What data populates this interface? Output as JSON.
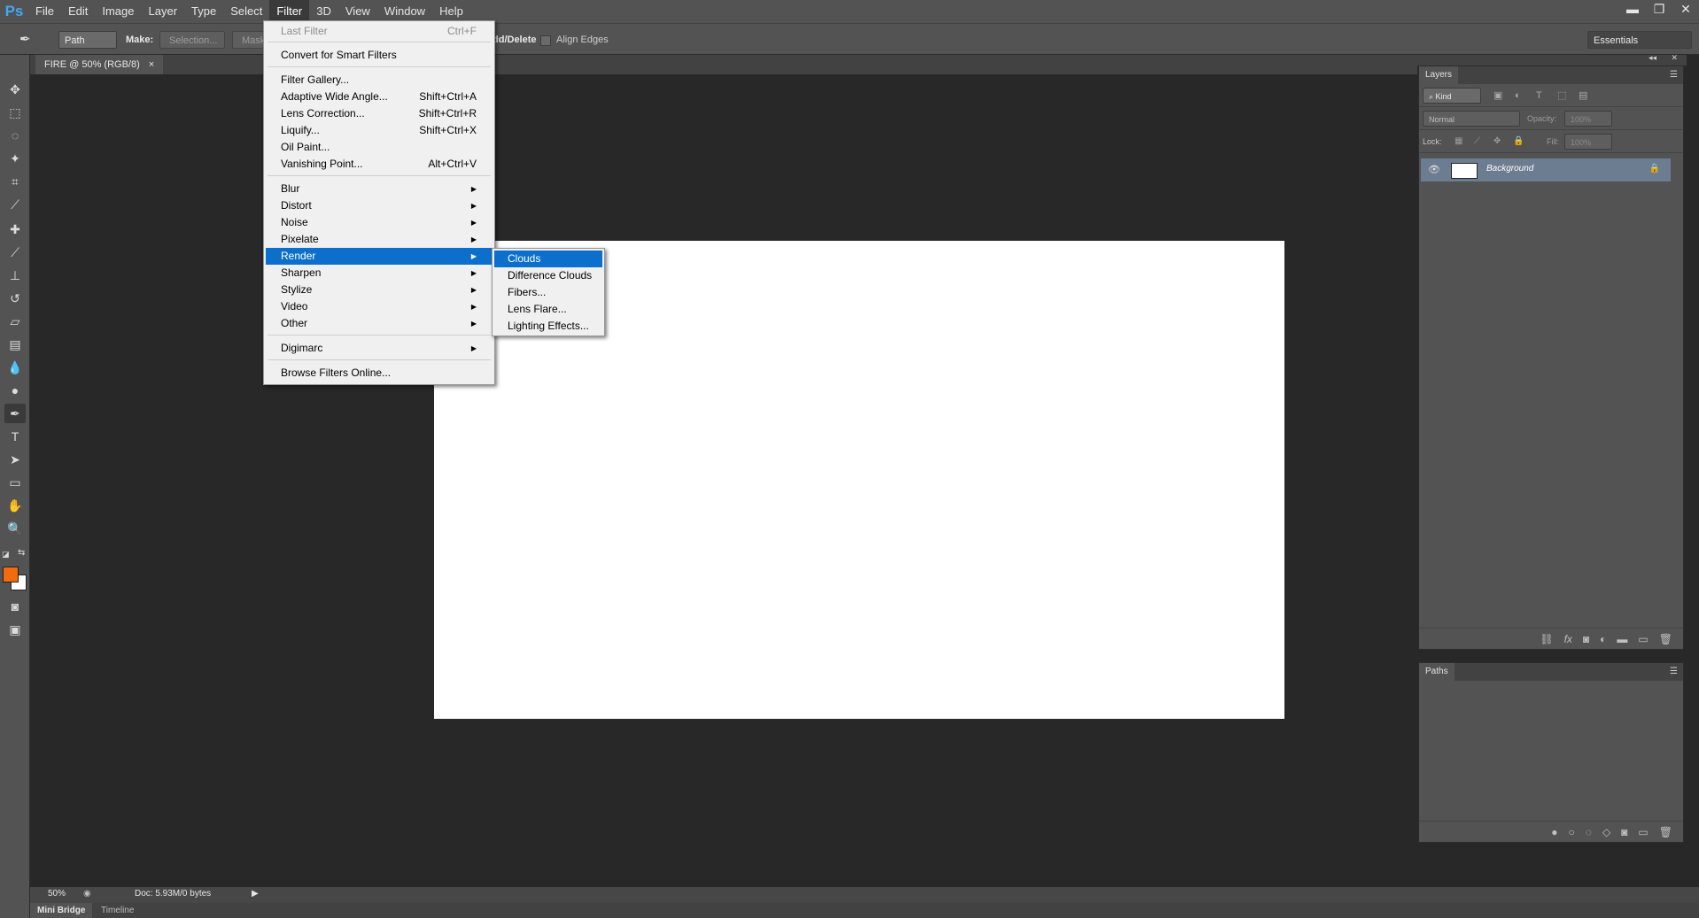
{
  "app": {
    "logo": "Ps",
    "menu": [
      "File",
      "Edit",
      "Image",
      "Layer",
      "Type",
      "Select",
      "Filter",
      "3D",
      "View",
      "Window",
      "Help"
    ],
    "active_menu": "Filter",
    "window_controls": {
      "minimize": "▬",
      "restore": "❐",
      "close": "✕"
    }
  },
  "options_bar": {
    "mode_select": "Path",
    "make_label": "Make:",
    "selection_button": "Selection...",
    "mask_button": "Mask",
    "auto_add_delete": "dd/Delete",
    "align_edges": "Align Edges",
    "workspace": "Essentials"
  },
  "document": {
    "tab_title": "FIRE @ 50% (RGB/8)",
    "tab_close": "×"
  },
  "filter_menu": {
    "items": [
      {
        "label": "Last Filter",
        "shortcut": "Ctrl+F",
        "disabled": true
      },
      {
        "label": "Convert for Smart Filters",
        "shortcut": ""
      },
      {
        "label": "Filter Gallery...",
        "shortcut": ""
      },
      {
        "label": "Adaptive Wide Angle...",
        "shortcut": "Shift+Ctrl+A"
      },
      {
        "label": "Lens Correction...",
        "shortcut": "Shift+Ctrl+R"
      },
      {
        "label": "Liquify...",
        "shortcut": "Shift+Ctrl+X"
      },
      {
        "label": "Oil Paint...",
        "shortcut": ""
      },
      {
        "label": "Vanishing Point...",
        "shortcut": "Alt+Ctrl+V"
      },
      {
        "label": "Blur",
        "submenu": true
      },
      {
        "label": "Distort",
        "submenu": true
      },
      {
        "label": "Noise",
        "submenu": true
      },
      {
        "label": "Pixelate",
        "submenu": true
      },
      {
        "label": "Render",
        "submenu": true,
        "highlight": true
      },
      {
        "label": "Sharpen",
        "submenu": true
      },
      {
        "label": "Stylize",
        "submenu": true
      },
      {
        "label": "Video",
        "submenu": true
      },
      {
        "label": "Other",
        "submenu": true
      },
      {
        "label": "Digimarc",
        "submenu": true
      },
      {
        "label": "Browse Filters Online...",
        "shortcut": ""
      }
    ]
  },
  "render_submenu": {
    "items": [
      "Clouds",
      "Difference Clouds",
      "Fibers...",
      "Lens Flare...",
      "Lighting Effects..."
    ],
    "highlighted": "Clouds"
  },
  "layers_panel": {
    "title": "Layers",
    "kind_filter": "Kind",
    "blend_mode": "Normal",
    "opacity_label": "Opacity:",
    "opacity_value": "100%",
    "lock_label": "Lock:",
    "fill_label": "Fill:",
    "fill_value": "100%",
    "layers": [
      {
        "name": "Background",
        "locked": true,
        "visible": true
      }
    ]
  },
  "paths_panel": {
    "title": "Paths"
  },
  "status_bar": {
    "zoom": "50%",
    "doc_info": "Doc: 5.93M/0 bytes"
  },
  "bottom_tabs": [
    "Mini Bridge",
    "Timeline"
  ],
  "colors": {
    "accent": "#0d6fcc",
    "foreground_color": "#f26b0f",
    "background_color": "#ffffff"
  }
}
